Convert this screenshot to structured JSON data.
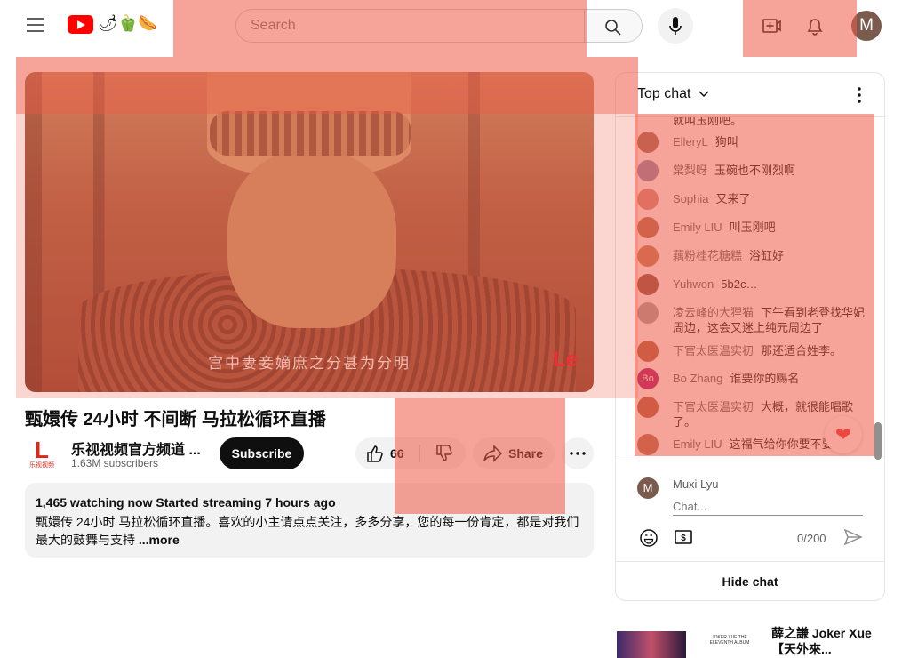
{
  "masthead": {
    "search_placeholder": "Search",
    "avatar_letter": "M",
    "doodle": "🌶🫑🌭"
  },
  "video": {
    "subtitle": "宫中妻妾嫡庶之分甚为分明",
    "watermark": "Le",
    "title": "甄嬛传 24小时 不间断 马拉松循环直播"
  },
  "channel": {
    "logo": "L",
    "logo_caption": "乐视视频",
    "name": "乐视视频官方频道 ...",
    "subscribers": "1.63M subscribers",
    "subscribe_label": "Subscribe"
  },
  "actions": {
    "like_count": "66",
    "share_label": "Share"
  },
  "description": {
    "stats": "1,465 watching now  Started streaming 7 hours ago",
    "text": "甄嬛传 24小时 马拉松循环直播。喜欢的小主请点点关注，多多分享，您的每一份肯定，都是对我们最大的鼓舞与支持 ",
    "more": "...more"
  },
  "chat": {
    "header": "Top chat",
    "partial_top": "就叫玉刚吧。",
    "messages": [
      {
        "author": "ElleryL",
        "text": "狗叫",
        "color": "#9c6b5a"
      },
      {
        "author": "棠梨呀",
        "text": "玉碗也不刚烈啊",
        "color": "#8a8ab0"
      },
      {
        "author": "Sophia",
        "text": "又来了",
        "color": "#d58b84"
      },
      {
        "author": "Emily LIU",
        "text": "叫玉刚吧",
        "color": "#b07050"
      },
      {
        "author": "藕粉桂花糖糕",
        "text": "浴缸好",
        "color": "#c47c5a"
      },
      {
        "author": "Yuhwon",
        "text": "5b2c…",
        "color": "#8a5040"
      },
      {
        "author": "凌云峰的大狸猫",
        "text": "下午看到老登找华妃周边，这会又迷上纯元周边了",
        "color": "#a2a2a2"
      },
      {
        "author": "下官太医温实初",
        "text": "那还适合姓李。",
        "color": "#b06040"
      },
      {
        "author": "Bo Zhang",
        "text": "谁要你的赐名",
        "color": "#b01070",
        "initials": "Bo"
      },
      {
        "author": "下官太医温实初",
        "text": "大概，就很能唱歌了。",
        "color": "#b06040"
      },
      {
        "author": "Emily LIU",
        "text": "这福气给你你要不要啊",
        "color": "#b07050"
      }
    ],
    "reaction": "❤",
    "me_initial": "M",
    "me_name": "Muxi Lyu",
    "input_placeholder": "Chat...",
    "char_count": "0/200",
    "hide_label": "Hide chat"
  },
  "related": {
    "thumb_text": "JOKER XUE THE ELEVENTH ALBUM",
    "title": "薛之謙 Joker Xue【天外來..."
  }
}
